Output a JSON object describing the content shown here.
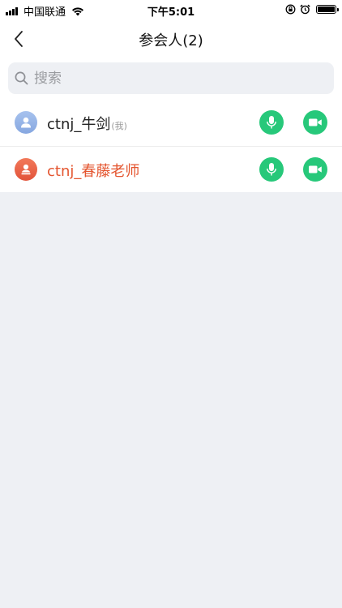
{
  "status_bar": {
    "carrier": "中国联通",
    "time": "下午5:01",
    "battery_level": 1.0
  },
  "nav": {
    "title": "参会人(2)"
  },
  "search": {
    "placeholder": "搜索",
    "value": ""
  },
  "participants": [
    {
      "name": "ctnj_牛剑",
      "suffix": "(我)",
      "avatar_color": "#8fadE4",
      "highlight": false
    },
    {
      "name": "ctnj_春藤老师",
      "suffix": "",
      "avatar_color": "#e85d3f",
      "highlight": true,
      "highlight_color": "#e4552f"
    }
  ],
  "colors": {
    "action_green": "#27c87a",
    "background": "#eef0f4"
  },
  "icons": {
    "back": "chevron-left-icon",
    "search": "search-icon",
    "mic": "microphone-icon",
    "camera": "video-camera-icon",
    "avatar": "person-icon"
  }
}
